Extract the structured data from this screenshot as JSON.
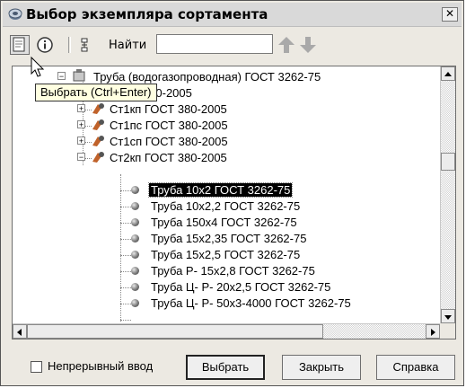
{
  "window": {
    "title": "Выбор экземпляра сортамента",
    "close_glyph": "✕"
  },
  "toolbar": {
    "find_label": "Найти",
    "find_value": "",
    "buttons": [
      "select-icon",
      "info-icon",
      "tree-view-icon",
      "arrow-up-icon",
      "arrow-down-icon"
    ]
  },
  "tooltip": "Выбрать (Ctrl+Enter)",
  "tree": {
    "rows": [
      {
        "label": "Труба (водогазопроводная) ГОСТ 3262-75"
      },
      {
        "label": "ГОСТ 380-2005"
      },
      {
        "label": "Ст1кп ГОСТ 380-2005"
      },
      {
        "label": "Ст1пс ГОСТ 380-2005"
      },
      {
        "label": "Ст1сп ГОСТ 380-2005"
      },
      {
        "label": "Ст2кп ГОСТ 380-2005"
      },
      {
        "label": "Труба 10х2 ГОСТ 3262-75",
        "selected": true
      },
      {
        "label": "Труба 10х2,2 ГОСТ 3262-75"
      },
      {
        "label": "Труба 150х4 ГОСТ 3262-75"
      },
      {
        "label": "Труба 15х2,35 ГОСТ 3262-75"
      },
      {
        "label": "Труба 15х2,5 ГОСТ 3262-75"
      },
      {
        "label": "Труба Р- 15х2,8 ГОСТ 3262-75"
      },
      {
        "label": "Труба Ц- Р- 20х2,5 ГОСТ 3262-75"
      },
      {
        "label": "Труба Ц- Р- 50х3-4000 ГОСТ 3262-75"
      }
    ],
    "expander_plus": "+",
    "expander_minus": "−"
  },
  "footer": {
    "continuous_label": "Непрерывный ввод",
    "continuous_checked": false,
    "select_label": "Выбрать",
    "close_label": "Закрыть",
    "help_label": "Справка"
  },
  "colors": {
    "selection_bg": "#000000",
    "arrow_color": "#a9a9a9"
  }
}
